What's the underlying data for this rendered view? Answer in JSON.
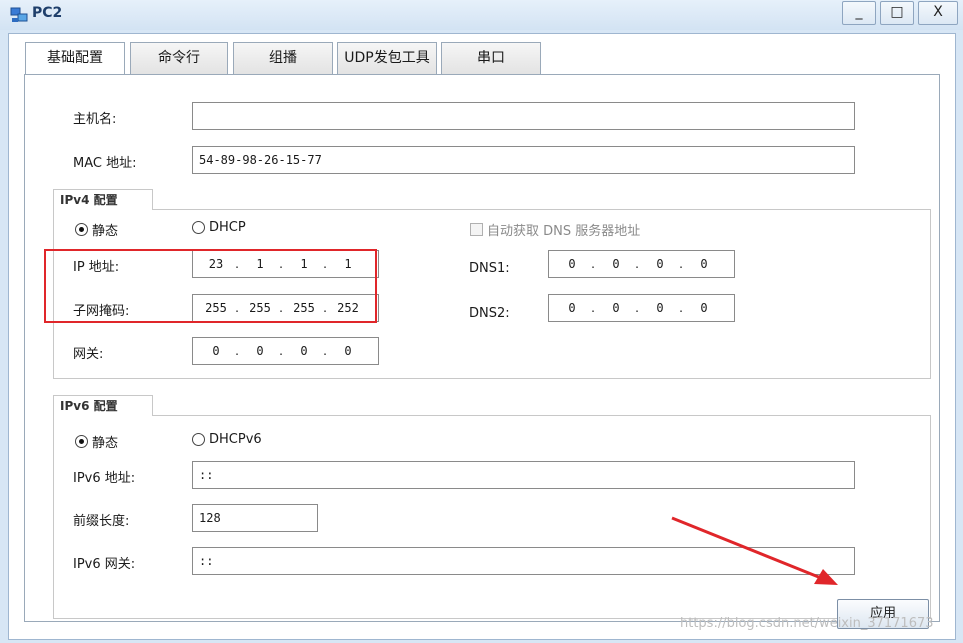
{
  "window": {
    "title": "PC2",
    "minimize": "_",
    "maximize": "□",
    "close": "X"
  },
  "tabs": [
    {
      "label": "基础配置"
    },
    {
      "label": "命令行"
    },
    {
      "label": "组播"
    },
    {
      "label": "UDP发包工具"
    },
    {
      "label": "串口"
    }
  ],
  "host": {
    "hostname_label": "主机名:",
    "hostname_value": "",
    "mac_label": "MAC 地址:",
    "mac_value": "54-89-98-26-15-77"
  },
  "ipv4": {
    "section_title": "IPv4 配置",
    "static_label": "静态",
    "dhcp_label": "DHCP",
    "auto_dns_label": "自动获取 DNS 服务器地址",
    "ip_label": "IP 地址:",
    "ip": [
      "23",
      "1",
      "1",
      "1"
    ],
    "mask_label": "子网掩码:",
    "mask": [
      "255",
      "255",
      "255",
      "252"
    ],
    "gateway_label": "网关:",
    "gateway": [
      "0",
      "0",
      "0",
      "0"
    ],
    "dns1_label": "DNS1:",
    "dns1": [
      "0",
      "0",
      "0",
      "0"
    ],
    "dns2_label": "DNS2:",
    "dns2": [
      "0",
      "0",
      "0",
      "0"
    ]
  },
  "ipv6": {
    "section_title": "IPv6 配置",
    "static_label": "静态",
    "dhcp_label": "DHCPv6",
    "addr_label": "IPv6 地址:",
    "addr_value": "::",
    "prefix_label": "前缀长度:",
    "prefix_value": "128",
    "gateway_label": "IPv6 网关:",
    "gateway_value": "::"
  },
  "apply_label": "应用",
  "watermark": "https://blog.csdn.net/weixin_37171673",
  "colors": {
    "highlight": "#e0262a",
    "window_bg": "#d7e6f5"
  }
}
